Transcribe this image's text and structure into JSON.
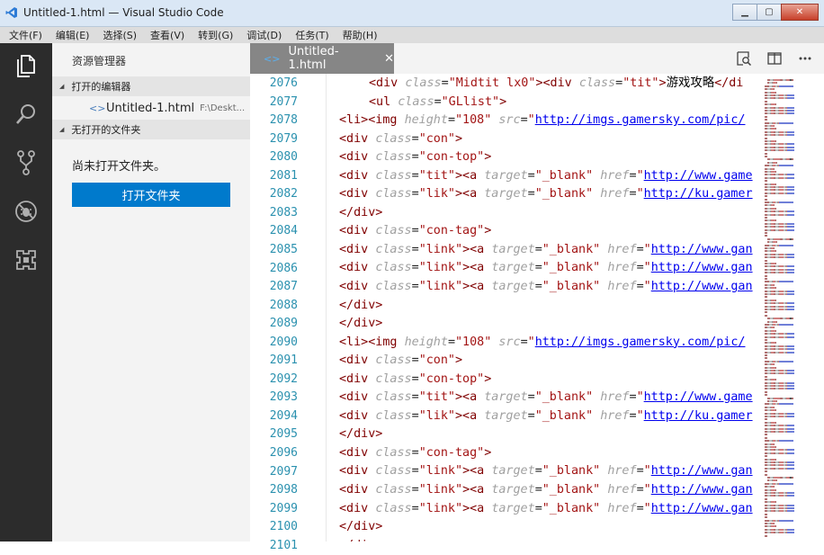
{
  "window": {
    "title": "Untitled-1.html — Visual Studio Code",
    "minimize": "▁",
    "maximize": "▢",
    "close": "✕"
  },
  "menu": [
    "文件(F)",
    "编辑(E)",
    "选择(S)",
    "查看(V)",
    "转到(G)",
    "调试(D)",
    "任务(T)",
    "帮助(H)"
  ],
  "activity": [
    {
      "name": "explorer-icon"
    },
    {
      "name": "search-icon"
    },
    {
      "name": "source-control-icon"
    },
    {
      "name": "debug-icon"
    },
    {
      "name": "extensions-icon"
    }
  ],
  "sidebar": {
    "title": "资源管理器",
    "open_editors_header": "打开的编辑器",
    "open_file_name": "Untitled-1.html",
    "open_file_path": "F:\\Deskt...",
    "no_folder_header": "无打开的文件夹",
    "no_folder_text": "尚未打开文件夹。",
    "open_folder_button": "打开文件夹"
  },
  "tab": {
    "label": "Untitled-1.html",
    "close": "✕"
  },
  "editor": {
    "lines": [
      {
        "n": "2076",
        "indent": "    ",
        "tokens": [
          [
            "tag",
            "<div "
          ],
          [
            "attr",
            "class"
          ],
          [
            "op",
            "="
          ],
          [
            "str",
            "\"Midtit lx0\""
          ],
          [
            "tag",
            "><div "
          ],
          [
            "attr",
            "class"
          ],
          [
            "op",
            "="
          ],
          [
            "str",
            "\"tit\""
          ],
          [
            "tag",
            ">"
          ],
          [
            "text",
            "游戏攻略"
          ],
          [
            "tag",
            "</di"
          ]
        ]
      },
      {
        "n": "2077",
        "indent": "    ",
        "tokens": [
          [
            "tag",
            "<ul "
          ],
          [
            "attr",
            "class"
          ],
          [
            "op",
            "="
          ],
          [
            "str",
            "\"GLlist\""
          ],
          [
            "tag",
            ">"
          ]
        ]
      },
      {
        "n": "2078",
        "indent": "",
        "tokens": [
          [
            "tag",
            "<li><img "
          ],
          [
            "attr",
            "height"
          ],
          [
            "op",
            "="
          ],
          [
            "str",
            "\"108\" "
          ],
          [
            "attr",
            "src"
          ],
          [
            "op",
            "="
          ],
          [
            "str",
            "\""
          ],
          [
            "url",
            "http://imgs.gamersky.com/pic/"
          ]
        ]
      },
      {
        "n": "2079",
        "indent": "",
        "tokens": [
          [
            "tag",
            "<div "
          ],
          [
            "attr",
            "class"
          ],
          [
            "op",
            "="
          ],
          [
            "str",
            "\"con\""
          ],
          [
            "tag",
            ">"
          ]
        ]
      },
      {
        "n": "2080",
        "indent": "",
        "tokens": [
          [
            "tag",
            "<div "
          ],
          [
            "attr",
            "class"
          ],
          [
            "op",
            "="
          ],
          [
            "str",
            "\"con-top\""
          ],
          [
            "tag",
            ">"
          ]
        ]
      },
      {
        "n": "2081",
        "indent": "",
        "tokens": [
          [
            "tag",
            "<div "
          ],
          [
            "attr",
            "class"
          ],
          [
            "op",
            "="
          ],
          [
            "str",
            "\"tit\""
          ],
          [
            "tag",
            "><a "
          ],
          [
            "attr",
            "target"
          ],
          [
            "op",
            "="
          ],
          [
            "str",
            "\"_blank\" "
          ],
          [
            "attr",
            "href"
          ],
          [
            "op",
            "="
          ],
          [
            "str",
            "\""
          ],
          [
            "url",
            "http://www.game"
          ]
        ]
      },
      {
        "n": "2082",
        "indent": "",
        "tokens": [
          [
            "tag",
            "<div "
          ],
          [
            "attr",
            "class"
          ],
          [
            "op",
            "="
          ],
          [
            "str",
            "\"lik\""
          ],
          [
            "tag",
            "><a "
          ],
          [
            "attr",
            "target"
          ],
          [
            "op",
            "="
          ],
          [
            "str",
            "\"_blank\" "
          ],
          [
            "attr",
            "href"
          ],
          [
            "op",
            "="
          ],
          [
            "str",
            "\""
          ],
          [
            "url",
            "http://ku.gamer"
          ]
        ]
      },
      {
        "n": "2083",
        "indent": "",
        "tokens": [
          [
            "tag",
            "</div>"
          ]
        ]
      },
      {
        "n": "2084",
        "indent": "",
        "tokens": [
          [
            "tag",
            "<div "
          ],
          [
            "attr",
            "class"
          ],
          [
            "op",
            "="
          ],
          [
            "str",
            "\"con-tag\""
          ],
          [
            "tag",
            ">"
          ]
        ]
      },
      {
        "n": "2085",
        "indent": "",
        "tokens": [
          [
            "tag",
            "<div "
          ],
          [
            "attr",
            "class"
          ],
          [
            "op",
            "="
          ],
          [
            "str",
            "\"link\""
          ],
          [
            "tag",
            "><a "
          ],
          [
            "attr",
            "target"
          ],
          [
            "op",
            "="
          ],
          [
            "str",
            "\"_blank\" "
          ],
          [
            "attr",
            "href"
          ],
          [
            "op",
            "="
          ],
          [
            "str",
            "\""
          ],
          [
            "url",
            "http://www.gan"
          ]
        ]
      },
      {
        "n": "2086",
        "indent": "",
        "tokens": [
          [
            "tag",
            "<div "
          ],
          [
            "attr",
            "class"
          ],
          [
            "op",
            "="
          ],
          [
            "str",
            "\"link\""
          ],
          [
            "tag",
            "><a "
          ],
          [
            "attr",
            "target"
          ],
          [
            "op",
            "="
          ],
          [
            "str",
            "\"_blank\" "
          ],
          [
            "attr",
            "href"
          ],
          [
            "op",
            "="
          ],
          [
            "str",
            "\""
          ],
          [
            "url",
            "http://www.gan"
          ]
        ]
      },
      {
        "n": "2087",
        "indent": "",
        "tokens": [
          [
            "tag",
            "<div "
          ],
          [
            "attr",
            "class"
          ],
          [
            "op",
            "="
          ],
          [
            "str",
            "\"link\""
          ],
          [
            "tag",
            "><a "
          ],
          [
            "attr",
            "target"
          ],
          [
            "op",
            "="
          ],
          [
            "str",
            "\"_blank\" "
          ],
          [
            "attr",
            "href"
          ],
          [
            "op",
            "="
          ],
          [
            "str",
            "\""
          ],
          [
            "url",
            "http://www.gan"
          ]
        ]
      },
      {
        "n": "2088",
        "indent": "",
        "tokens": [
          [
            "tag",
            "</div>"
          ]
        ]
      },
      {
        "n": "2089",
        "indent": "",
        "tokens": [
          [
            "tag",
            "</div>"
          ]
        ]
      },
      {
        "n": "2090",
        "indent": "",
        "tokens": [
          [
            "tag",
            "<li><img "
          ],
          [
            "attr",
            "height"
          ],
          [
            "op",
            "="
          ],
          [
            "str",
            "\"108\" "
          ],
          [
            "attr",
            "src"
          ],
          [
            "op",
            "="
          ],
          [
            "str",
            "\""
          ],
          [
            "url",
            "http://imgs.gamersky.com/pic/"
          ]
        ]
      },
      {
        "n": "2091",
        "indent": "",
        "tokens": [
          [
            "tag",
            "<div "
          ],
          [
            "attr",
            "class"
          ],
          [
            "op",
            "="
          ],
          [
            "str",
            "\"con\""
          ],
          [
            "tag",
            ">"
          ]
        ]
      },
      {
        "n": "2092",
        "indent": "",
        "tokens": [
          [
            "tag",
            "<div "
          ],
          [
            "attr",
            "class"
          ],
          [
            "op",
            "="
          ],
          [
            "str",
            "\"con-top\""
          ],
          [
            "tag",
            ">"
          ]
        ]
      },
      {
        "n": "2093",
        "indent": "",
        "tokens": [
          [
            "tag",
            "<div "
          ],
          [
            "attr",
            "class"
          ],
          [
            "op",
            "="
          ],
          [
            "str",
            "\"tit\""
          ],
          [
            "tag",
            "><a "
          ],
          [
            "attr",
            "target"
          ],
          [
            "op",
            "="
          ],
          [
            "str",
            "\"_blank\" "
          ],
          [
            "attr",
            "href"
          ],
          [
            "op",
            "="
          ],
          [
            "str",
            "\""
          ],
          [
            "url",
            "http://www.game"
          ]
        ]
      },
      {
        "n": "2094",
        "indent": "",
        "tokens": [
          [
            "tag",
            "<div "
          ],
          [
            "attr",
            "class"
          ],
          [
            "op",
            "="
          ],
          [
            "str",
            "\"lik\""
          ],
          [
            "tag",
            "><a "
          ],
          [
            "attr",
            "target"
          ],
          [
            "op",
            "="
          ],
          [
            "str",
            "\"_blank\" "
          ],
          [
            "attr",
            "href"
          ],
          [
            "op",
            "="
          ],
          [
            "str",
            "\""
          ],
          [
            "url",
            "http://ku.gamer"
          ]
        ]
      },
      {
        "n": "2095",
        "indent": "",
        "tokens": [
          [
            "tag",
            "</div>"
          ]
        ]
      },
      {
        "n": "2096",
        "indent": "",
        "tokens": [
          [
            "tag",
            "<div "
          ],
          [
            "attr",
            "class"
          ],
          [
            "op",
            "="
          ],
          [
            "str",
            "\"con-tag\""
          ],
          [
            "tag",
            ">"
          ]
        ]
      },
      {
        "n": "2097",
        "indent": "",
        "tokens": [
          [
            "tag",
            "<div "
          ],
          [
            "attr",
            "class"
          ],
          [
            "op",
            "="
          ],
          [
            "str",
            "\"link\""
          ],
          [
            "tag",
            "><a "
          ],
          [
            "attr",
            "target"
          ],
          [
            "op",
            "="
          ],
          [
            "str",
            "\"_blank\" "
          ],
          [
            "attr",
            "href"
          ],
          [
            "op",
            "="
          ],
          [
            "str",
            "\""
          ],
          [
            "url",
            "http://www.gan"
          ]
        ]
      },
      {
        "n": "2098",
        "indent": "",
        "tokens": [
          [
            "tag",
            "<div "
          ],
          [
            "attr",
            "class"
          ],
          [
            "op",
            "="
          ],
          [
            "str",
            "\"link\""
          ],
          [
            "tag",
            "><a "
          ],
          [
            "attr",
            "target"
          ],
          [
            "op",
            "="
          ],
          [
            "str",
            "\"_blank\" "
          ],
          [
            "attr",
            "href"
          ],
          [
            "op",
            "="
          ],
          [
            "str",
            "\""
          ],
          [
            "url",
            "http://www.gan"
          ]
        ]
      },
      {
        "n": "2099",
        "indent": "",
        "tokens": [
          [
            "tag",
            "<div "
          ],
          [
            "attr",
            "class"
          ],
          [
            "op",
            "="
          ],
          [
            "str",
            "\"link\""
          ],
          [
            "tag",
            "><a "
          ],
          [
            "attr",
            "target"
          ],
          [
            "op",
            "="
          ],
          [
            "str",
            "\"_blank\" "
          ],
          [
            "attr",
            "href"
          ],
          [
            "op",
            "="
          ],
          [
            "str",
            "\""
          ],
          [
            "url",
            "http://www.gan"
          ]
        ]
      },
      {
        "n": "2100",
        "indent": "",
        "tokens": [
          [
            "tag",
            "</div>"
          ]
        ]
      },
      {
        "n": "2101",
        "indent": "",
        "tokens": [
          [
            "tag",
            "</div"
          ]
        ]
      }
    ]
  },
  "colors": {
    "accent": "#007acc",
    "activity_bar": "#2c2c2c",
    "tab_active": "#868686",
    "line_number": "#2b91af"
  }
}
